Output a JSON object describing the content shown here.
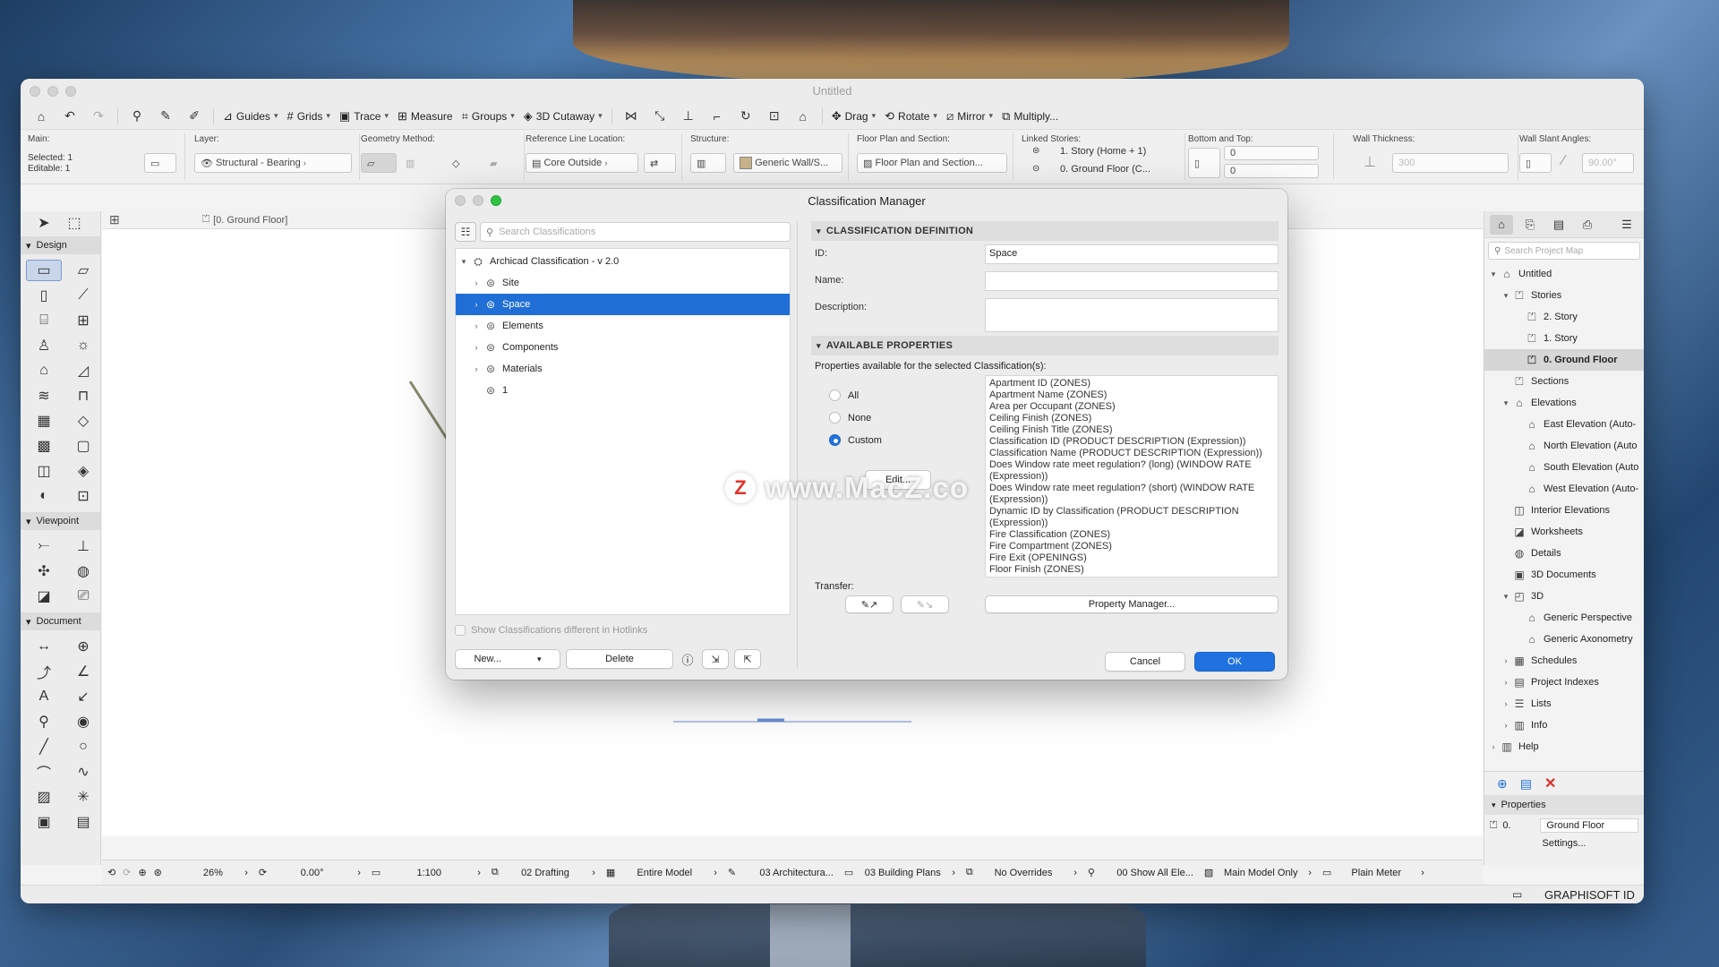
{
  "window": {
    "title": "Untitled"
  },
  "toolbar": {
    "guides": "Guides",
    "grids": "Grids",
    "trace": "Trace",
    "measure": "Measure",
    "groups": "Groups",
    "cutaway": "3D Cutaway",
    "drag": "Drag",
    "rotate": "Rotate",
    "mirror": "Mirror",
    "multiply": "Multiply..."
  },
  "infobox": {
    "main_label": "Main:",
    "selected": "Selected: 1",
    "editable": "Editable: 1",
    "layer_label": "Layer:",
    "layer_value": "Structural - Bearing",
    "geometry_label": "Geometry Method:",
    "refline_label": "Reference Line Location:",
    "refline_value": "Core Outside",
    "structure_label": "Structure:",
    "structure_value": "Generic Wall/S...",
    "floorplan_label": "Floor Plan and Section:",
    "floorplan_value": "Floor Plan and Section...",
    "linked_label": "Linked Stories:",
    "linked_top": "1. Story (Home + 1)",
    "linked_bottom": "0. Ground Floor (C...",
    "bottomtop_label": "Bottom and Top:",
    "top_value": "0",
    "bottom_value": "0",
    "thickness_label": "Wall Thickness:",
    "thickness_value": "300",
    "slant_label": "Wall Slant Angles:",
    "slant_value": "90.00°"
  },
  "toolbox": {
    "design": "Design",
    "viewpoint": "Viewpoint",
    "document": "Document"
  },
  "canvas": {
    "tab_label": "[0. Ground Floor]"
  },
  "navigator": {
    "search_placeholder": "Search Project Map",
    "items": [
      {
        "label": "Untitled"
      },
      {
        "label": "Stories"
      },
      {
        "label": "2. Story"
      },
      {
        "label": "1. Story"
      },
      {
        "label": "0. Ground Floor"
      },
      {
        "label": "Sections"
      },
      {
        "label": "Elevations"
      },
      {
        "label": "East Elevation (Auto-"
      },
      {
        "label": "North Elevation (Auto"
      },
      {
        "label": "South Elevation (Auto"
      },
      {
        "label": "West Elevation (Auto-"
      },
      {
        "label": "Interior Elevations"
      },
      {
        "label": "Worksheets"
      },
      {
        "label": "Details"
      },
      {
        "label": "3D Documents"
      },
      {
        "label": "3D"
      },
      {
        "label": "Generic Perspective"
      },
      {
        "label": "Generic Axonometry"
      },
      {
        "label": "Schedules"
      },
      {
        "label": "Project Indexes"
      },
      {
        "label": "Lists"
      },
      {
        "label": "Info"
      },
      {
        "label": "Help"
      }
    ],
    "properties_label": "Properties",
    "prop_id": "0.",
    "prop_value": "Ground Floor",
    "settings": "Settings...",
    "graphisoft": "GRAPHISOFT ID"
  },
  "statusbar": {
    "zoom": "26%",
    "angle": "0.00°",
    "scale": "1:100",
    "layer_combo": "02 Drafting",
    "model": "Entire Model",
    "pen": "03 Architectura...",
    "view": "03 Building Plans",
    "overrides": "No Overrides",
    "renovation": "00 Show All Ele...",
    "model_only": "Main Model Only",
    "unit": "Plain Meter"
  },
  "dialog": {
    "title": "Classification Manager",
    "search_placeholder": "Search Classifications",
    "tree": [
      {
        "label": "Archicad Classification - v 2.0"
      },
      {
        "label": "Site"
      },
      {
        "label": "Space"
      },
      {
        "label": "Elements"
      },
      {
        "label": "Components"
      },
      {
        "label": "Materials"
      },
      {
        "label": "1"
      }
    ],
    "show_hotlinks": "Show Classifications different in Hotlinks",
    "new_button": "New...",
    "delete_button": "Delete",
    "def_header": "CLASSIFICATION DEFINITION",
    "id_label": "ID:",
    "id_value": "Space",
    "name_label": "Name:",
    "name_value": "",
    "desc_label": "Description:",
    "desc_value": "",
    "avail_header": "AVAILABLE PROPERTIES",
    "avail_caption": "Properties available for the selected Classification(s):",
    "radio_all": "All",
    "radio_none": "None",
    "radio_custom": "Custom",
    "edit_button": "Edit...",
    "properties": [
      "Apartment ID (ZONES)",
      "Apartment Name (ZONES)",
      "Area per Occupant (ZONES)",
      "Ceiling Finish (ZONES)",
      "Ceiling Finish Title (ZONES)",
      "Classification ID (PRODUCT DESCRIPTION (Expression))",
      "Classification Name (PRODUCT DESCRIPTION (Expression))",
      "Does Window rate meet regulation? (long) (WINDOW RATE (Expression))",
      "Does Window rate meet regulation? (short) (WINDOW RATE (Expression))",
      "Dynamic ID by Classification (PRODUCT DESCRIPTION (Expression))",
      "Fire Classification (ZONES)",
      "Fire Compartment (ZONES)",
      "Fire Exit (OPENINGS)",
      "Floor Finish (ZONES)"
    ],
    "transfer_label": "Transfer:",
    "property_manager": "Property Manager...",
    "cancel": "Cancel",
    "ok": "OK"
  },
  "watermark": "www.MacZ.co",
  "colors": {
    "accent": "#1f72e0",
    "selection": "#1f6fd6"
  }
}
